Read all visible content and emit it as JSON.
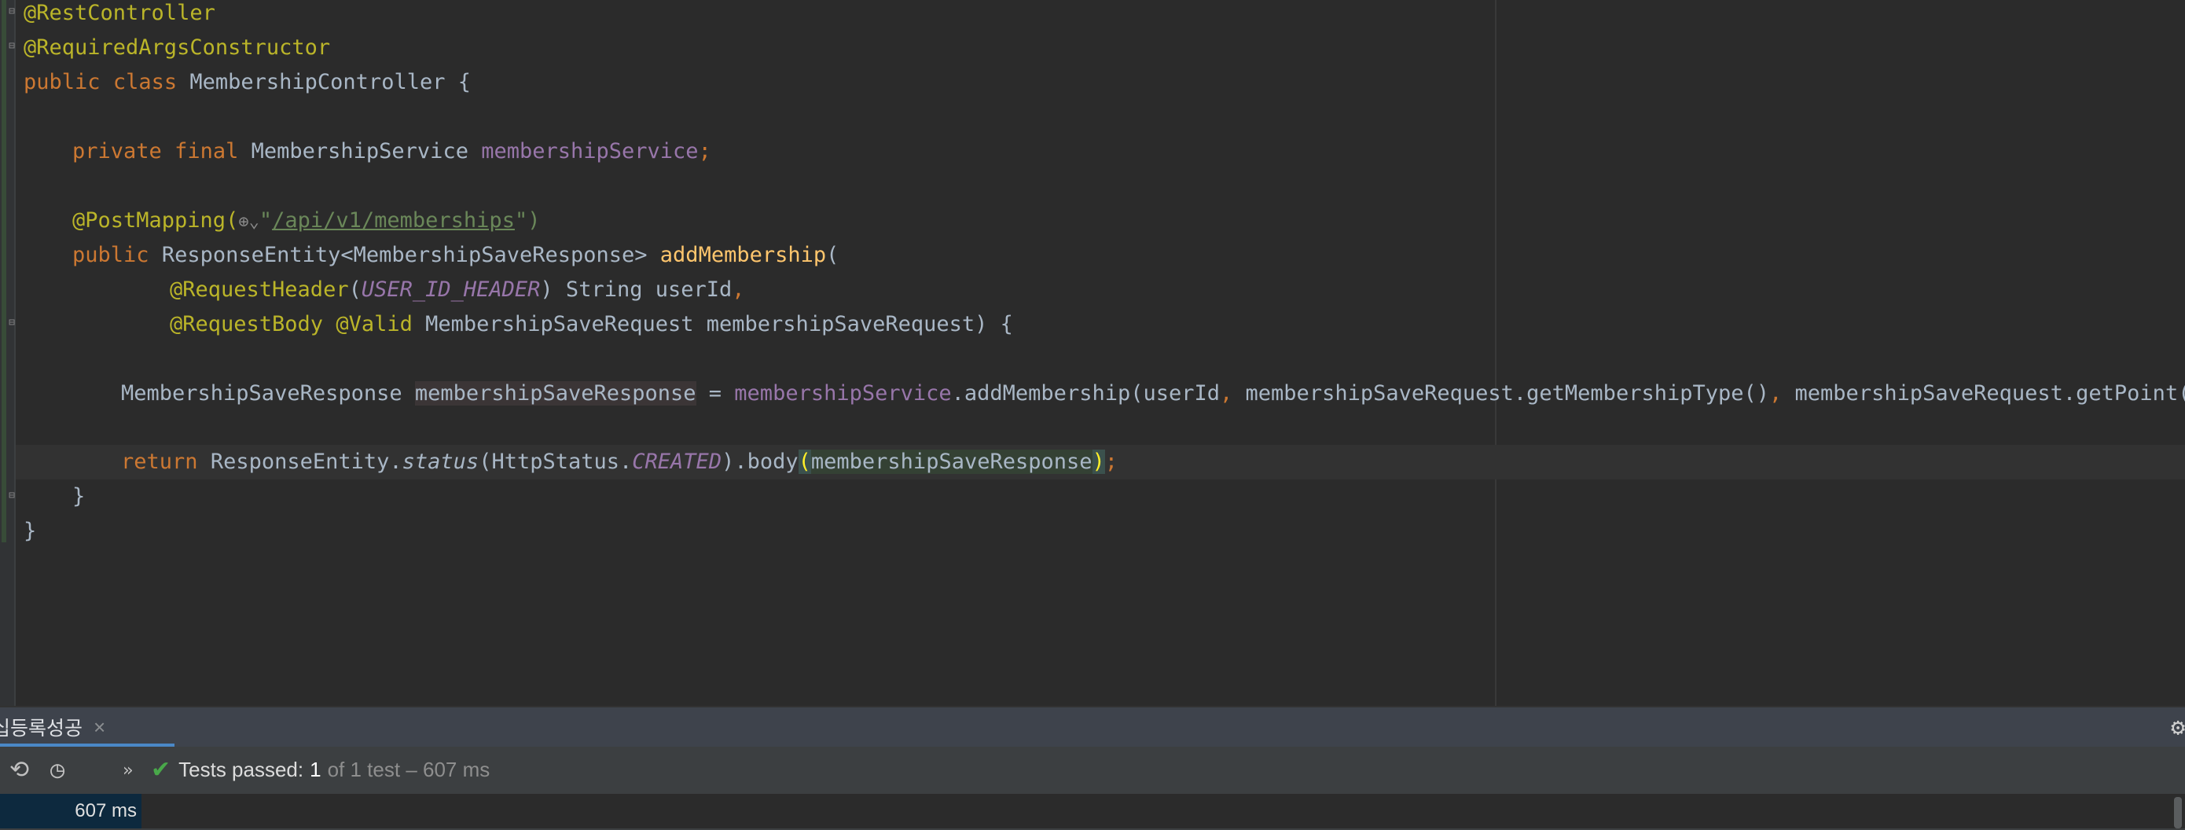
{
  "editor": {
    "lines": [
      {
        "annotation": "@RestController"
      },
      {
        "annotation": "@RequiredArgsConstructor"
      },
      {
        "kw_public": "public",
        "kw_class": "class",
        "name": "MembershipController {"
      },
      {
        "kw_private": "private",
        "kw_final": "final",
        "type": "MembershipService",
        "field": "membershipService",
        "semi": ";"
      },
      {
        "annotation": "@PostMapping(",
        "quote_open": "\"",
        "url": "/api/v1/memberships",
        "tail": "\")"
      },
      {
        "kw_public": "public",
        "type": "ResponseEntity<MembershipSaveResponse>",
        "method": "addMembership",
        "tail": "("
      },
      {
        "annotation": "@RequestHeader",
        "paren": "(",
        "constant": "USER_ID_HEADER",
        "tail": ") String userId",
        "comma": ","
      },
      {
        "annotation1": "@RequestBody",
        "annotation2": "@Valid",
        "tail": "MembershipSaveRequest membershipSaveRequest) {"
      },
      {
        "type": "MembershipSaveResponse",
        "var": "membershipSaveResponse",
        "eq": " = ",
        "field": "membershipService",
        "call": ".addMembership(userId",
        "comma1": ",",
        "arg2": " membershipSaveRequest.getMembershipType()",
        "comma2": ",",
        "arg3": " membershipSaveRequest.getPoint());"
      },
      {
        "kw_return": "return",
        "type": "ResponseEntity.",
        "method_italic": "status",
        "arg_open": "(HttpStatus.",
        "constant": "CREATED",
        "chain": ").body",
        "paren_open": "(",
        "arg": "membershipSaveResponse",
        "paren_close": ")",
        "semi": ";"
      },
      {
        "text": "}"
      },
      {
        "text": "}"
      }
    ]
  },
  "panel": {
    "tab_label": "십등록성공",
    "tab_close": "×",
    "status": {
      "label": "Tests passed:",
      "count": "1",
      "rest": "of 1 test – 607 ms"
    },
    "tree_time": "607 ms"
  },
  "icons": {
    "fold": "fold-marker-icon",
    "globe": "globe-icon",
    "check": "check-icon",
    "gear": "gear-icon",
    "rerun": "rerun-icon",
    "history": "history-icon",
    "expand": "expand-chevrons-icon"
  },
  "colors": {
    "background": "#2b2b2b",
    "keyword": "#cc7832",
    "annotation": "#bbb529",
    "field": "#9876aa",
    "method": "#ffc66d",
    "string": "#6a8759",
    "text": "#a9b7c6",
    "pass": "#49a84a",
    "accent": "#4a88c7"
  }
}
